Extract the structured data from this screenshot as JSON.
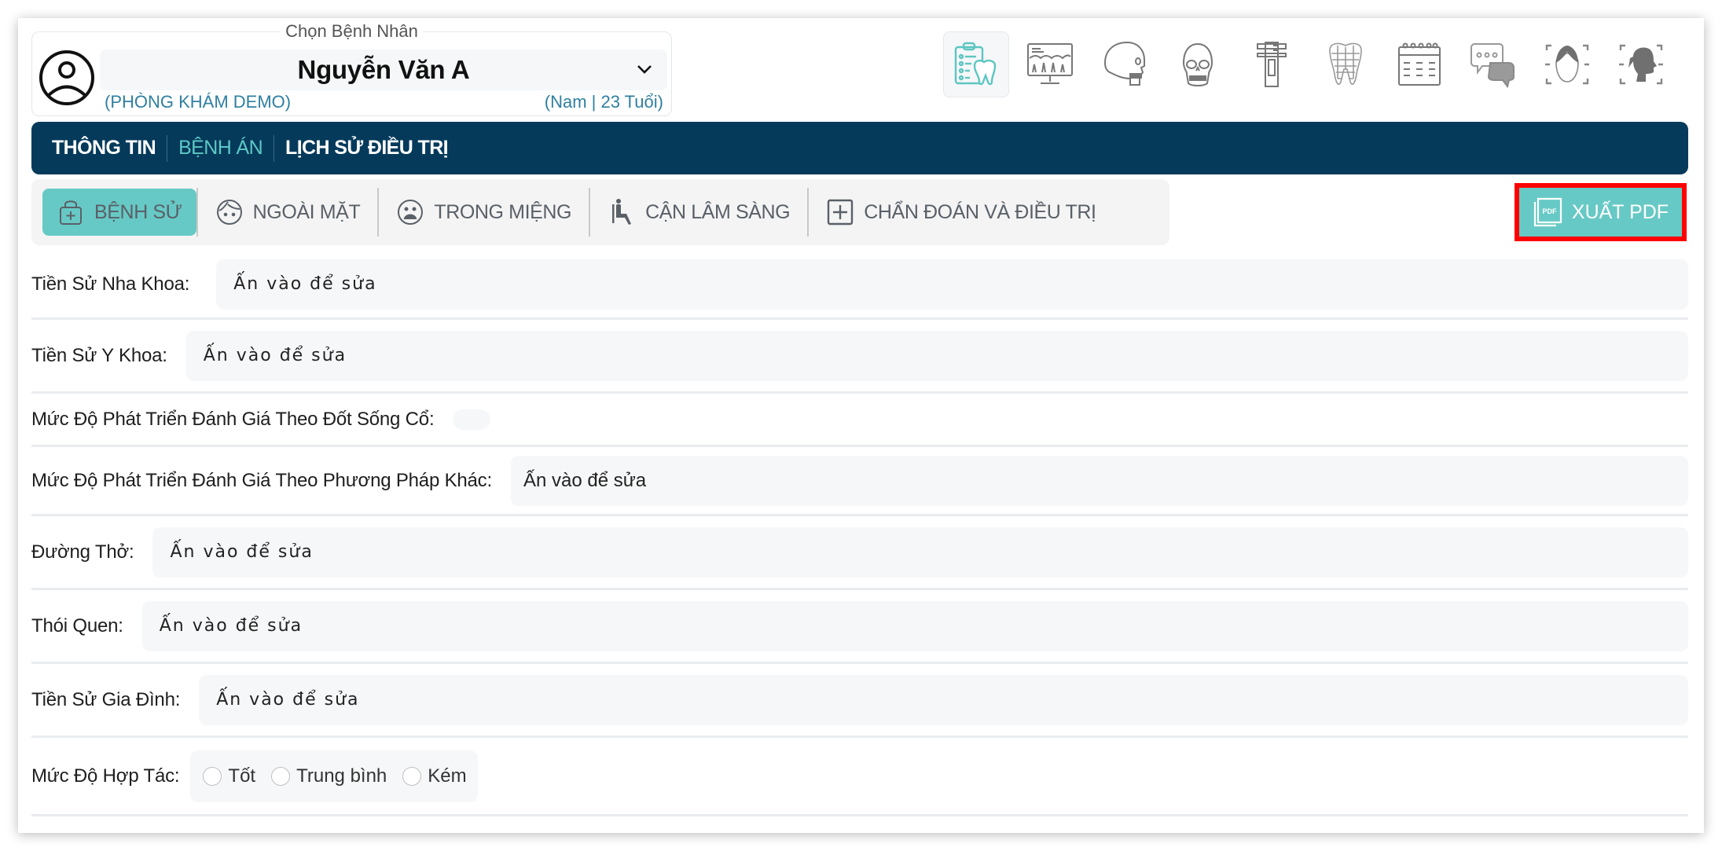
{
  "patient": {
    "legend": "Chọn Bệnh Nhân",
    "name": "Nguyễn Văn A",
    "clinic": "(PHÒNG KHÁM DEMO)",
    "meta": "(Nam | 23 Tuổi)"
  },
  "tool_icons": [
    {
      "name": "dental-record-icon",
      "active": true
    },
    {
      "name": "xray-monitor-icon",
      "active": false
    },
    {
      "name": "skull-side-icon",
      "active": false
    },
    {
      "name": "skull-front-icon",
      "active": false
    },
    {
      "name": "caliper-icon",
      "active": false
    },
    {
      "name": "tooth-3d-icon",
      "active": false
    },
    {
      "name": "calendar-icon",
      "active": false
    },
    {
      "name": "chat-icon",
      "active": false
    },
    {
      "name": "face-scan-front-icon",
      "active": false
    },
    {
      "name": "face-scan-side-icon",
      "active": false
    }
  ],
  "nav": {
    "items": [
      {
        "label": "THÔNG TIN",
        "active": false
      },
      {
        "label": "BỆNH ÁN",
        "active": true
      },
      {
        "label": "LỊCH SỬ ĐIỀU TRỊ",
        "active": false
      }
    ]
  },
  "subtabs": [
    {
      "label": "BỆNH SỬ",
      "icon": "medical-bag-icon",
      "active": true
    },
    {
      "label": "NGOÀI MẶT",
      "icon": "face-icon",
      "active": false
    },
    {
      "label": "TRONG MIỆNG",
      "icon": "mouth-face-icon",
      "active": false
    },
    {
      "label": "CẬN LÂM SÀNG",
      "icon": "patient-chair-icon",
      "active": false
    },
    {
      "label": "CHẨN ĐOÁN VÀ ĐIỀU TRỊ",
      "icon": "plus-square-icon",
      "active": false
    }
  ],
  "export": {
    "label": "XUẤT PDF"
  },
  "form": {
    "rows": [
      {
        "label": "Tiền Sử Nha Khoa:",
        "value": "Ấn vào để sửa"
      },
      {
        "label": "Tiền Sử Y Khoa:",
        "value": "Ấn vào để sửa"
      },
      {
        "label": "Mức Độ Phát Triển Đánh Giá Theo Đốt Sống Cổ:",
        "value": ""
      },
      {
        "label": "Mức Độ Phát Triển Đánh Giá Theo Phương Pháp Khác:",
        "value": "Ấn vào để sửa"
      },
      {
        "label": "Đường Thở:",
        "value": "Ấn vào để sửa"
      },
      {
        "label": "Thói Quen:",
        "value": "Ấn vào để sửa"
      },
      {
        "label": "Tiền Sử Gia Đình:",
        "value": "Ấn vào để sửa"
      }
    ],
    "cooperation": {
      "label": "Mức Độ Hợp Tác:",
      "options": [
        "Tốt",
        "Trung bình",
        "Kém"
      ],
      "selected": null
    }
  },
  "colors": {
    "navbar": "#053a5b",
    "accent": "#67c9c5",
    "nav_active": "#5ec8c5",
    "highlight": "#ff0000"
  }
}
